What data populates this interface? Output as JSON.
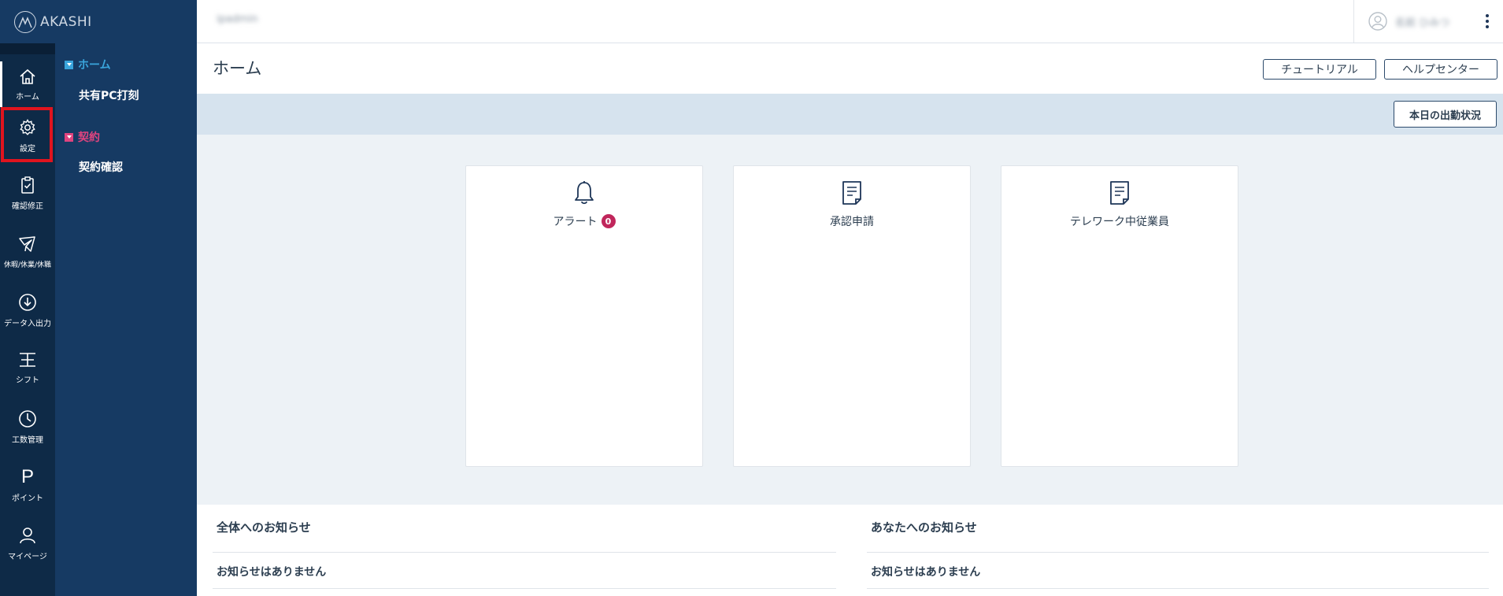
{
  "app": {
    "name": "AKASHI"
  },
  "topbar": {
    "company": "ipadmin",
    "user": "名前 ひみつ"
  },
  "rail": [
    {
      "label": "ホーム",
      "icon": "home-icon"
    },
    {
      "label": "設定",
      "icon": "gear-icon"
    },
    {
      "label": "確認修正",
      "icon": "clipboard-check-icon"
    },
    {
      "label": "休暇/休業/休職",
      "icon": "plane-icon"
    },
    {
      "label": "データ入出力",
      "icon": "download-icon"
    },
    {
      "label": "シフト",
      "icon": "shift-icon"
    },
    {
      "label": "工数管理",
      "icon": "clock-icon"
    },
    {
      "label": "ポイント",
      "icon": "point-icon"
    },
    {
      "label": "マイページ",
      "icon": "user-icon"
    }
  ],
  "side": {
    "home_section": "ホーム",
    "home_item": "共有PC打刻",
    "contract_section": "契約",
    "contract_item": "契約確認",
    "colors": {
      "home": "#3aa5dc",
      "contract": "#e0447f"
    }
  },
  "header": {
    "title": "ホーム",
    "tutorial": "チュートリアル",
    "help": "ヘルプセンター",
    "today_status": "本日の出勤状況"
  },
  "cards": [
    {
      "title": "アラート",
      "badge": "0",
      "icon": "bell-icon"
    },
    {
      "title": "承認申請",
      "icon": "document-icon"
    },
    {
      "title": "テレワーク中従業員",
      "icon": "document-icon"
    }
  ],
  "notices": {
    "all_title": "全体へのお知らせ",
    "all_empty": "お知らせはありません",
    "you_title": "あなたへのお知らせ",
    "you_empty": "お知らせはありません"
  }
}
